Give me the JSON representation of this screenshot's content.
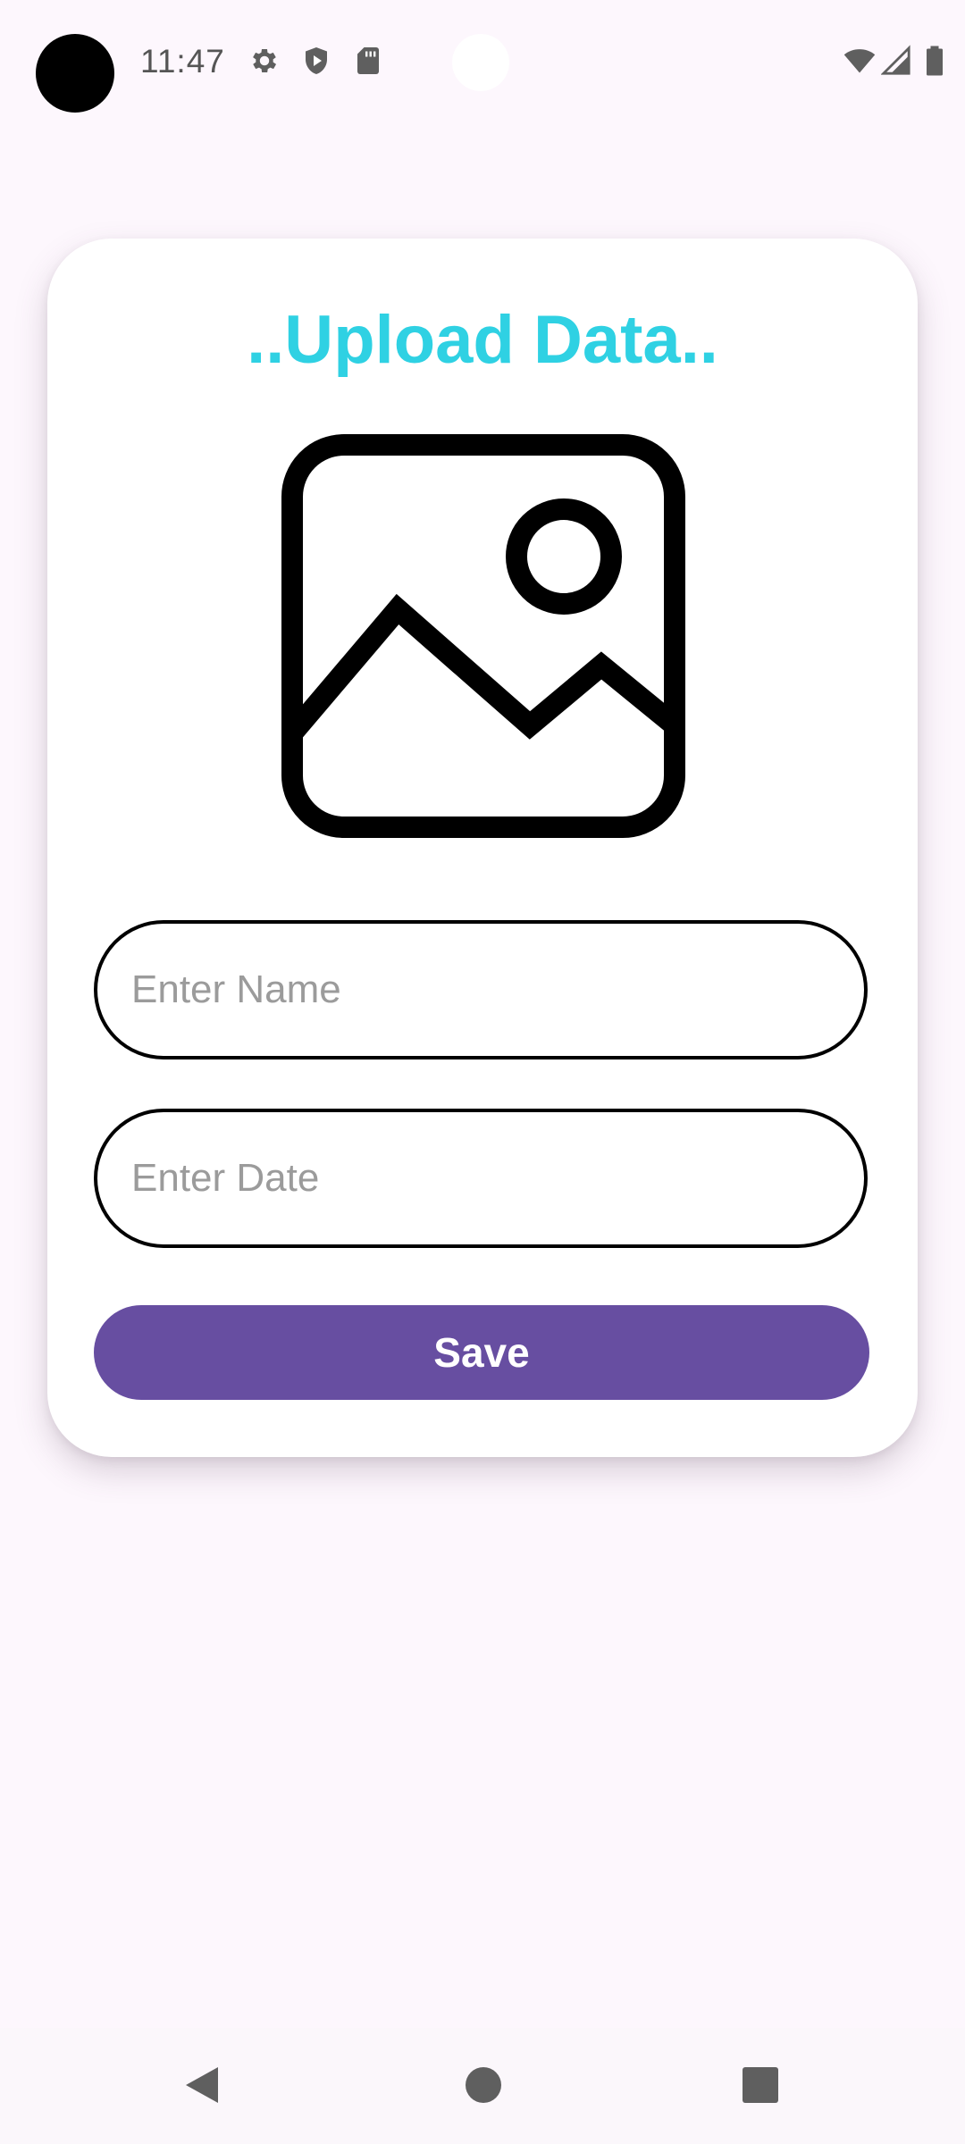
{
  "status_bar": {
    "time": "11:47",
    "icons_left": [
      "gear-icon",
      "shield-play-icon",
      "sd-card-icon"
    ],
    "icons_right": [
      "wifi-icon",
      "cell-signal-icon",
      "battery-icon"
    ]
  },
  "card": {
    "title": "..Upload Data..",
    "image_icon": "image-placeholder-icon",
    "name_input": {
      "placeholder": "Enter Name",
      "value": ""
    },
    "date_input": {
      "placeholder": "Enter Date",
      "value": ""
    },
    "save_label": "Save"
  },
  "nav_bar": {
    "buttons": [
      "back-icon",
      "home-icon",
      "recents-icon"
    ]
  },
  "colors": {
    "title": "#2fd1e3",
    "button": "#674ea1",
    "background": "#fdf7fd"
  }
}
